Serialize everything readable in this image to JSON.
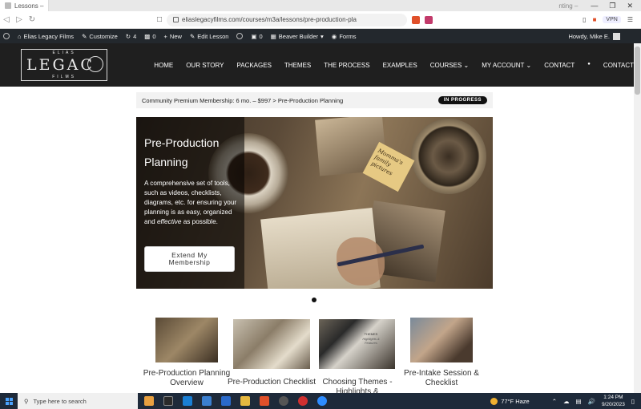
{
  "browser": {
    "tab_title": "Lessons –",
    "tab2_title": "nting –",
    "url": "eliaslegacyfilms.com/courses/m3a/lessons/pre-production-pla",
    "vpn_label": "VPN"
  },
  "wp_admin_bar": {
    "site_name": "Elias Legacy Films",
    "customize": "Customize",
    "updates_count": "4",
    "comments_count": "0",
    "new_label": "New",
    "edit_label": "Edit Lesson",
    "counter": "0",
    "builder_label": "Beaver Builder",
    "forms_label": "Forms",
    "howdy": "Howdy, Mike E."
  },
  "logo": {
    "top": "ELIAS",
    "main": "LEGAC",
    "bottom": "FILMS"
  },
  "nav": {
    "items": [
      "HOME",
      "OUR STORY",
      "PACKAGES",
      "THEMES",
      "THE PROCESS",
      "EXAMPLES",
      "COURSES",
      "MY ACCOUNT",
      "CONTACT",
      "CONTACT"
    ]
  },
  "breadcrumb": {
    "text": "Community Premium Membership: 6 mo. – $997 > Pre-Production Planning",
    "status": "IN PROGRESS"
  },
  "hero": {
    "title": "Pre-Production Planning",
    "text_before": "A comprehensive set of tools, such as videos, checklists, diagrams, etc. for ensuring your planning is as easy, organized and ",
    "text_em": "effective",
    "text_after": " as possible.",
    "button": "Extend My Membership",
    "sticky_note": "Momma's family pictures"
  },
  "cards": [
    {
      "label": "Pre-Production Planning Overview"
    },
    {
      "label": "Pre-Production Checklist"
    },
    {
      "label": "Choosing Themes - Highlights &"
    },
    {
      "label": "Pre-Intake Session & Checklist"
    }
  ],
  "card_thumb_texts": {
    "themes_title": "THEMES",
    "themes_sub": "Highlights & Features"
  },
  "taskbar": {
    "search_placeholder": "Type here to search",
    "weather": "77°F  Haze",
    "time": "1:24 PM",
    "date": "9/20/2023"
  }
}
